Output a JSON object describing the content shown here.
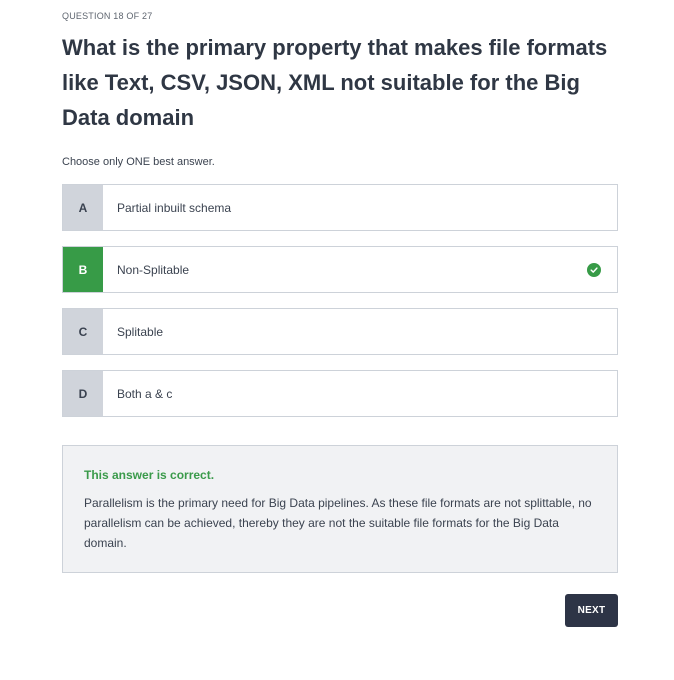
{
  "question": {
    "counter": "QUESTION 18 OF 27",
    "title": "What is the primary property that makes file formats like Text, CSV, JSON, XML not suitable for the Big Data domain",
    "instruction": "Choose only ONE best answer."
  },
  "options": [
    {
      "letter": "A",
      "text": "Partial inbuilt schema",
      "selected": false
    },
    {
      "letter": "B",
      "text": "Non-Splitable",
      "selected": true,
      "icon": "check-circle-icon"
    },
    {
      "letter": "C",
      "text": "Splitable",
      "selected": false
    },
    {
      "letter": "D",
      "text": "Both a & c",
      "selected": false
    }
  ],
  "feedback": {
    "title": "This answer is correct.",
    "text": "Parallelism is the primary need for Big Data pipelines. As these file formats are not splittable, no parallelism can be achieved, thereby they are not the suitable file formats for the Big Data domain."
  },
  "actions": {
    "next_label": "NEXT"
  },
  "colors": {
    "correct": "#379b47",
    "letter_bg": "#d0d4db",
    "button_bg": "#2d3446",
    "feedback_bg": "#f1f2f4"
  }
}
